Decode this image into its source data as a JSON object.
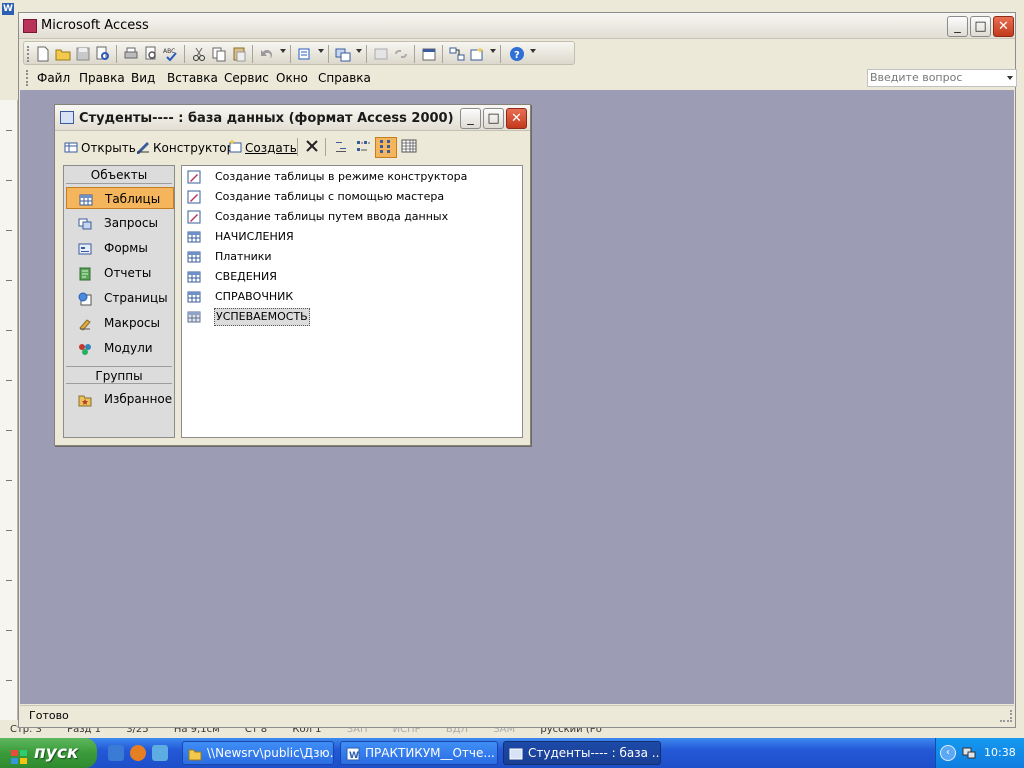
{
  "access_window": {
    "title": "Microsoft Access",
    "status_text": "Готово"
  },
  "menu": {
    "items": [
      "Файл",
      "Правка",
      "Вид",
      "Вставка",
      "Сервис",
      "Окно",
      "Справка"
    ],
    "ask_placeholder": "Введите вопрос"
  },
  "db_window": {
    "title": "Студенты---- : база данных (формат Access 2000)",
    "toolbar": {
      "open_label": "Открыть",
      "design_label": "Конструктор",
      "create_label": "Создать"
    },
    "objects_header": "Объекты",
    "objects": [
      "Таблицы",
      "Запросы",
      "Формы",
      "Отчеты",
      "Страницы",
      "Макросы",
      "Модули"
    ],
    "selected_object": "Таблицы",
    "groups_header": "Группы",
    "groups": [
      "Избранное"
    ],
    "list_items": [
      "Создание таблицы в режиме конструктора",
      "Создание таблицы с помощью мастера",
      "Создание таблицы путем ввода данных",
      "НАЧИСЛЕНИЯ",
      "Платники",
      "СВЕДЕНИЯ",
      "СПРАВОЧНИК",
      "УСПЕВАЕМОСТЬ"
    ],
    "selected_item": "УСПЕВАЕМОСТЬ"
  },
  "background_status": {
    "items": [
      "Стр. 3",
      "Разд 1",
      "3/25",
      "На 9,1см",
      "Ст 8",
      "Кол 1",
      "ЗАП",
      "ИСПР",
      "ВДЛ",
      "ЗАМ",
      "русский (Ро"
    ]
  },
  "taskbar": {
    "start_label": "пуск",
    "tasks": [
      "\\\\Newsrv\\public\\Дзю...",
      "ПРАКТИКУМ__Отче...",
      "Студенты---- : база ..."
    ],
    "active_task": "Студенты---- : база ...",
    "clock": "10:38"
  },
  "colors": {
    "mdi_background": "#9c9cb5",
    "selection_orange": "#f4b55d",
    "taskbar_blue": "#2458d6",
    "start_green": "#3a9b3a"
  }
}
